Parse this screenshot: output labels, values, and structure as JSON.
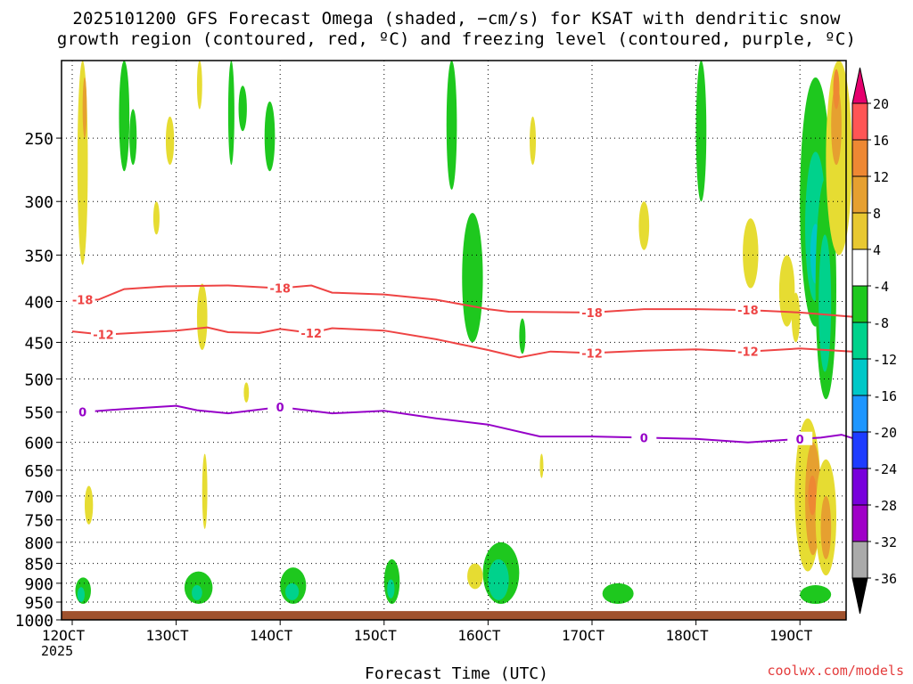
{
  "title_line1": "2025101200 GFS Forecast Omega (shaded, −cm/s) for KSAT with dendritic snow",
  "title_line2": "growth region (contoured, red, ºC) and freezing level (contoured, purple, ºC)",
  "credit": "coolwx.com/models",
  "chart_data": {
    "type": "heatmap",
    "xlabel": "Forecast Time (UTC)",
    "x_year_label": "2025",
    "x_ticks": [
      "12OCT",
      "13OCT",
      "14OCT",
      "15OCT",
      "16OCT",
      "17OCT",
      "18OCT",
      "19OCT"
    ],
    "y_scale": "log",
    "y_ticks": [
      250,
      300,
      350,
      400,
      450,
      500,
      550,
      600,
      650,
      700,
      750,
      800,
      850,
      900,
      950,
      1000
    ],
    "ylim": [
      1000,
      200
    ],
    "grid": true,
    "colorbar": {
      "levels": [
        "20",
        "16",
        "12",
        "8",
        "4",
        "-4",
        "-8",
        "-12",
        "-16",
        "-20",
        "-24",
        "-28",
        "-32",
        "-36"
      ],
      "colors": [
        "#ff5555",
        "#ee8833",
        "#e6a030",
        "#e8c832",
        "#e6dc32",
        "#ffffff",
        "#1ec81e",
        "#00d28c",
        "#00c8c8",
        "#1e96ff",
        "#1e3cff",
        "#7800dc",
        "#a000c8",
        "#aaaaaa",
        "#000000",
        "#e6006e"
      ]
    },
    "contours": [
      {
        "label": "-18",
        "color": "#ee4444",
        "points": [
          [
            0,
            392
          ],
          [
            0.1,
            398
          ],
          [
            0.25,
            398
          ],
          [
            0.5,
            386
          ],
          [
            0.9,
            383
          ],
          [
            1.5,
            382
          ],
          [
            2.0,
            385
          ],
          [
            2.3,
            382
          ],
          [
            2.5,
            390
          ],
          [
            3.0,
            392
          ],
          [
            3.5,
            398
          ],
          [
            4.0,
            409
          ],
          [
            4.2,
            412
          ],
          [
            5.0,
            413
          ],
          [
            5.5,
            409
          ],
          [
            6.0,
            409
          ],
          [
            6.5,
            410
          ],
          [
            7.0,
            413
          ],
          [
            7.5,
            418
          ],
          [
            7.6,
            425
          ]
        ]
      },
      {
        "label": "-12",
        "color": "#ee4444",
        "points": [
          [
            0,
            436
          ],
          [
            0.3,
            440
          ],
          [
            1.0,
            435
          ],
          [
            1.3,
            431
          ],
          [
            1.5,
            437
          ],
          [
            1.8,
            438
          ],
          [
            2.0,
            433
          ],
          [
            2.3,
            438
          ],
          [
            2.5,
            432
          ],
          [
            3.0,
            435
          ],
          [
            3.5,
            446
          ],
          [
            4.0,
            460
          ],
          [
            4.3,
            470
          ],
          [
            4.6,
            462
          ],
          [
            5.0,
            464
          ],
          [
            5.5,
            461
          ],
          [
            6.0,
            459
          ],
          [
            6.5,
            462
          ],
          [
            7.0,
            458
          ],
          [
            7.5,
            462
          ],
          [
            7.6,
            466
          ]
        ]
      },
      {
        "label": "0",
        "color": "#9600c8",
        "points": [
          [
            0,
            540
          ],
          [
            0.1,
            550
          ],
          [
            0.5,
            545
          ],
          [
            1.0,
            540
          ],
          [
            1.2,
            547
          ],
          [
            1.5,
            552
          ],
          [
            2.0,
            542
          ],
          [
            2.5,
            552
          ],
          [
            3.0,
            548
          ],
          [
            3.5,
            560
          ],
          [
            4.0,
            570
          ],
          [
            4.5,
            590
          ],
          [
            5.0,
            590
          ],
          [
            5.5,
            592
          ],
          [
            6.0,
            594
          ],
          [
            6.5,
            600
          ],
          [
            7.0,
            594
          ],
          [
            7.2,
            592
          ],
          [
            7.4,
            587
          ],
          [
            7.6,
            598
          ]
        ]
      }
    ]
  }
}
